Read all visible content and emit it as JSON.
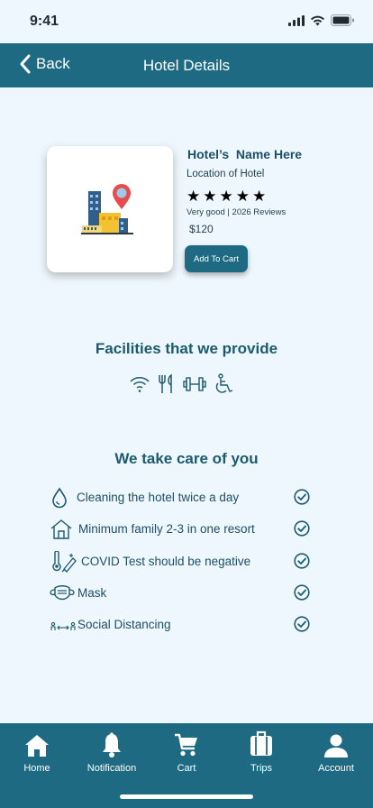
{
  "status_bar": {
    "time": "9:41"
  },
  "nav": {
    "back_label": "Back",
    "title": "Hotel Details"
  },
  "hotel": {
    "name": "Hotel’s  Name Here",
    "location": "Location of Hotel",
    "rating_stars": 5,
    "reviews": "Very good | 2026 Reviews",
    "price": "$120",
    "add_to_cart_label": "Add To Cart"
  },
  "facilities": {
    "title": "Facilities that we provide",
    "icons": [
      "wifi-icon",
      "restaurant-icon",
      "gym-icon",
      "accessibility-icon"
    ]
  },
  "care": {
    "title": "We take care of you",
    "items": [
      {
        "label": "Cleaning the hotel twice a day",
        "icon": "water-drop-icon"
      },
      {
        "label": "Minimum family 2-3 in one resort",
        "icon": "house-icon"
      },
      {
        "label": "COVID Test should be negative",
        "icon": "covid-test-icon"
      },
      {
        "label": "Mask",
        "icon": "mask-icon"
      },
      {
        "label": "Social Distancing",
        "icon": "social-distancing-icon"
      }
    ]
  },
  "tabs": [
    {
      "label": "Home",
      "icon": "home-icon"
    },
    {
      "label": "Notification",
      "icon": "bell-icon"
    },
    {
      "label": "Cart",
      "icon": "cart-icon"
    },
    {
      "label": "Trips",
      "icon": "suitcase-icon"
    },
    {
      "label": "Account",
      "icon": "user-icon"
    }
  ],
  "colors": {
    "primary": "#1d6a82",
    "background": "#eef7fd",
    "text": "#1d5a6e"
  }
}
